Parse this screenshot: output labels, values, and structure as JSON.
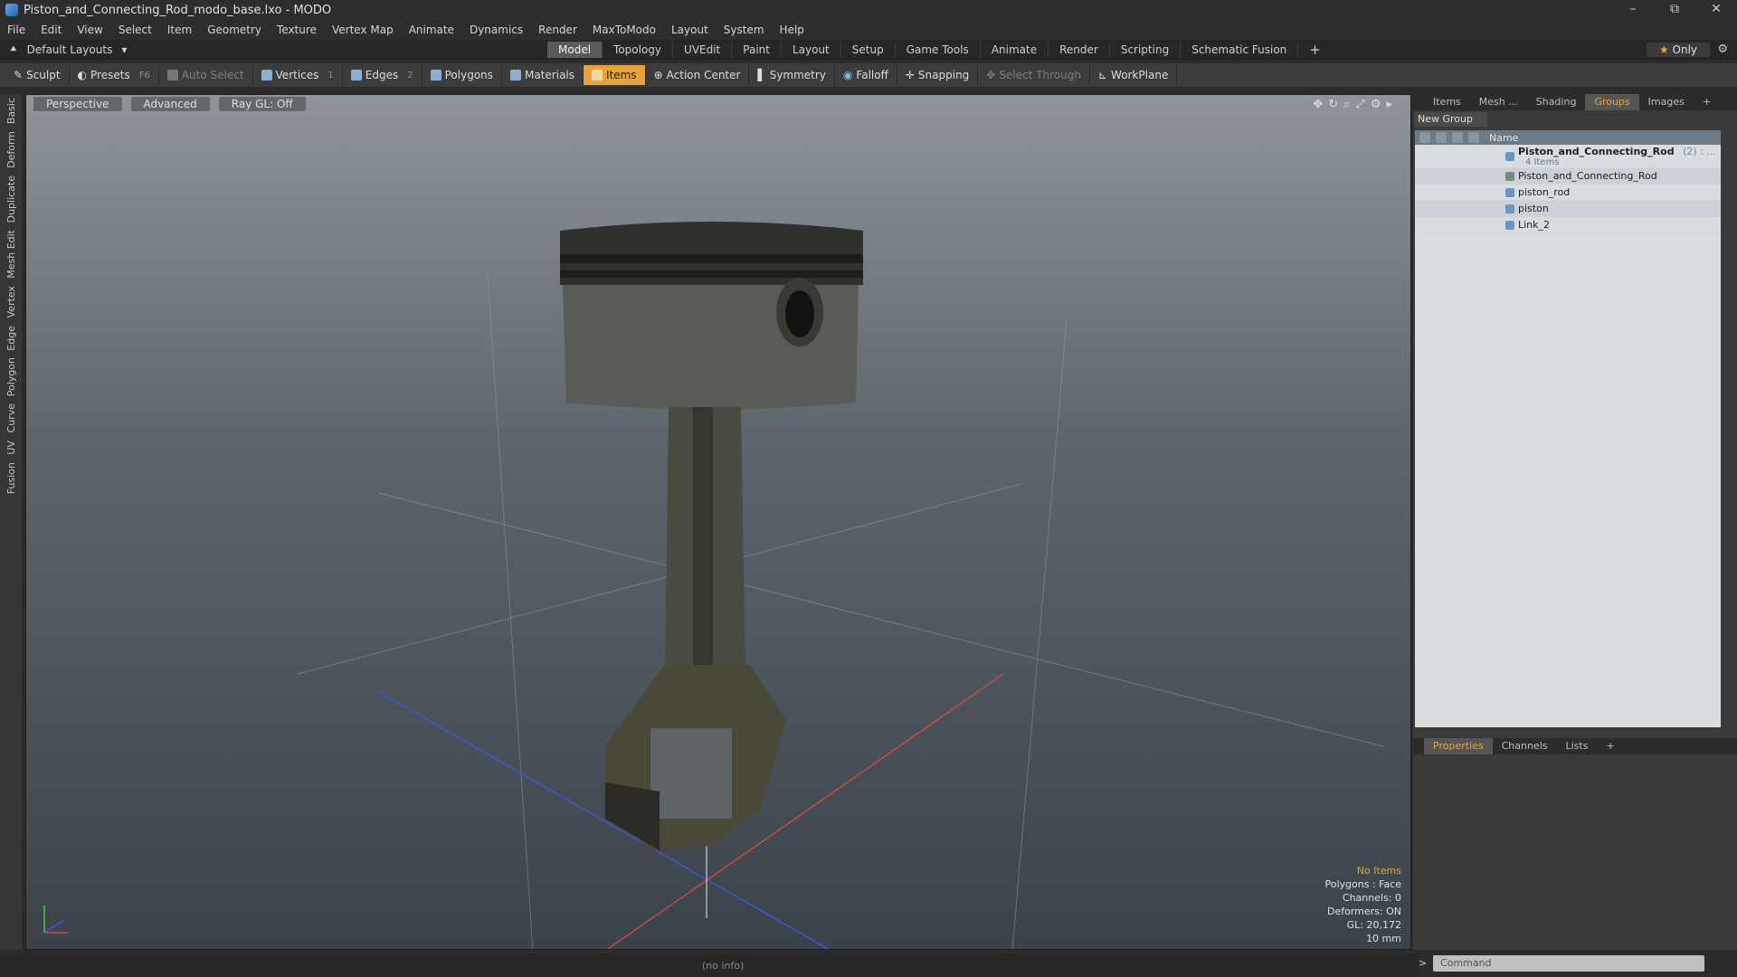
{
  "window": {
    "title": "Piston_and_Connecting_Rod_modo_base.lxo - MODO",
    "controls": [
      "–",
      "⧉",
      "✕"
    ]
  },
  "menu": [
    "File",
    "Edit",
    "View",
    "Select",
    "Item",
    "Geometry",
    "Texture",
    "Vertex Map",
    "Animate",
    "Dynamics",
    "Render",
    "MaxToModo",
    "Layout",
    "System",
    "Help"
  ],
  "layouts": {
    "dropdown_label": "Default Layouts",
    "tabs": [
      "Model",
      "Topology",
      "UVEdit",
      "Paint",
      "Layout",
      "Setup",
      "Game Tools",
      "Animate",
      "Render",
      "Scripting",
      "Schematic Fusion"
    ],
    "active_tab": "Model",
    "only_label": "Only"
  },
  "toolbar": {
    "sculpt": "Sculpt",
    "presets": "Presets",
    "presets_key": "F6",
    "auto_select": "Auto Select",
    "vertices": "Vertices",
    "vertices_key": "1",
    "edges": "Edges",
    "edges_key": "2",
    "polygons": "Polygons",
    "materials": "Materials",
    "items": "Items",
    "action_center": "Action Center",
    "symmetry": "Symmetry",
    "falloff": "Falloff",
    "snapping": "Snapping",
    "select_through": "Select Through",
    "workplane": "WorkPlane"
  },
  "left_tabs": [
    "Basic",
    "Deform",
    "Duplicate",
    "Mesh Edit",
    "Vertex",
    "Edge",
    "Polygon",
    "Curve",
    "UV",
    "Fusion"
  ],
  "viewport": {
    "view_mode": "Perspective",
    "shading": "Advanced",
    "raygl": "Ray GL: Off",
    "stats": {
      "selection": "No Items",
      "polygons": "Polygons : Face",
      "channels": "Channels: 0",
      "deformers": "Deformers: ON",
      "gl": "GL: 20,172",
      "grid": "10 mm"
    }
  },
  "status": {
    "info": "(no info)"
  },
  "right_panel": {
    "tabs": [
      "Items",
      "Mesh ...",
      "Shading",
      "Groups",
      "Images"
    ],
    "active_tab": "Groups",
    "new_group": "New Group",
    "list_header": "Name",
    "group": {
      "name": "Piston_and_Connecting_Rod",
      "count": "(2) : ...",
      "subtitle": "4 Items"
    },
    "children": [
      "Piston_and_Connecting_Rod",
      "piston_rod",
      "piston",
      "Link_2"
    ],
    "bottom_tabs": [
      "Properties",
      "Channels",
      "Lists"
    ],
    "bottom_active": "Properties"
  },
  "command": {
    "placeholder": "Command"
  }
}
